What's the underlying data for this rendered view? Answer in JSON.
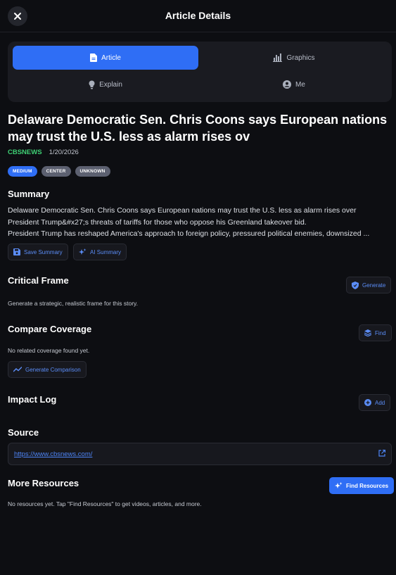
{
  "header": {
    "title": "Article Details"
  },
  "tabs": [
    {
      "label": "Article",
      "icon": "document-icon",
      "active": true
    },
    {
      "label": "Graphics",
      "icon": "bar-chart-icon",
      "active": false
    },
    {
      "label": "Explain",
      "icon": "lightbulb-icon",
      "active": false
    },
    {
      "label": "Me",
      "icon": "user-circle-icon",
      "active": false
    }
  ],
  "article": {
    "title": "Delaware Democratic Sen. Chris Coons says European nations may trust the U.S. less as alarm rises ov",
    "source": "CBSNEWS",
    "date": "1/20/2026",
    "badges": [
      "MEDIUM",
      "CENTER",
      "UNKNOWN"
    ]
  },
  "summary": {
    "heading": "Summary",
    "lines": [
      "Delaware Democratic Sen. Chris Coons says European nations may trust the U.S. less as alarm rises over",
      "President Trump&#x27;s threats of tariffs for those who oppose his Greenland takeover bid.",
      "President Trump has reshaped America's approach to foreign policy, pressured political enemies, downsized ..."
    ],
    "save_label": "Save Summary",
    "ai_label": "AI Summary"
  },
  "critical_frame": {
    "heading": "Critical Frame",
    "button": "Generate",
    "text": "Generate a strategic, realistic frame for this story."
  },
  "compare": {
    "heading": "Compare Coverage",
    "button": "Find",
    "text": "No related coverage found yet.",
    "generate_label": "Generate Comparison"
  },
  "impact": {
    "heading": "Impact Log",
    "button": "Add"
  },
  "source": {
    "heading": "Source",
    "url": "https://www.cbsnews.com/"
  },
  "resources": {
    "heading": "More Resources",
    "button": "Find Resources",
    "text": "No resources yet. Tap \"Find Resources\" to get videos, articles, and more."
  },
  "colors": {
    "background": "#0d0e12",
    "accent": "#2f6ef5",
    "source_green": "#3ecf74",
    "link": "#4d84f5"
  }
}
